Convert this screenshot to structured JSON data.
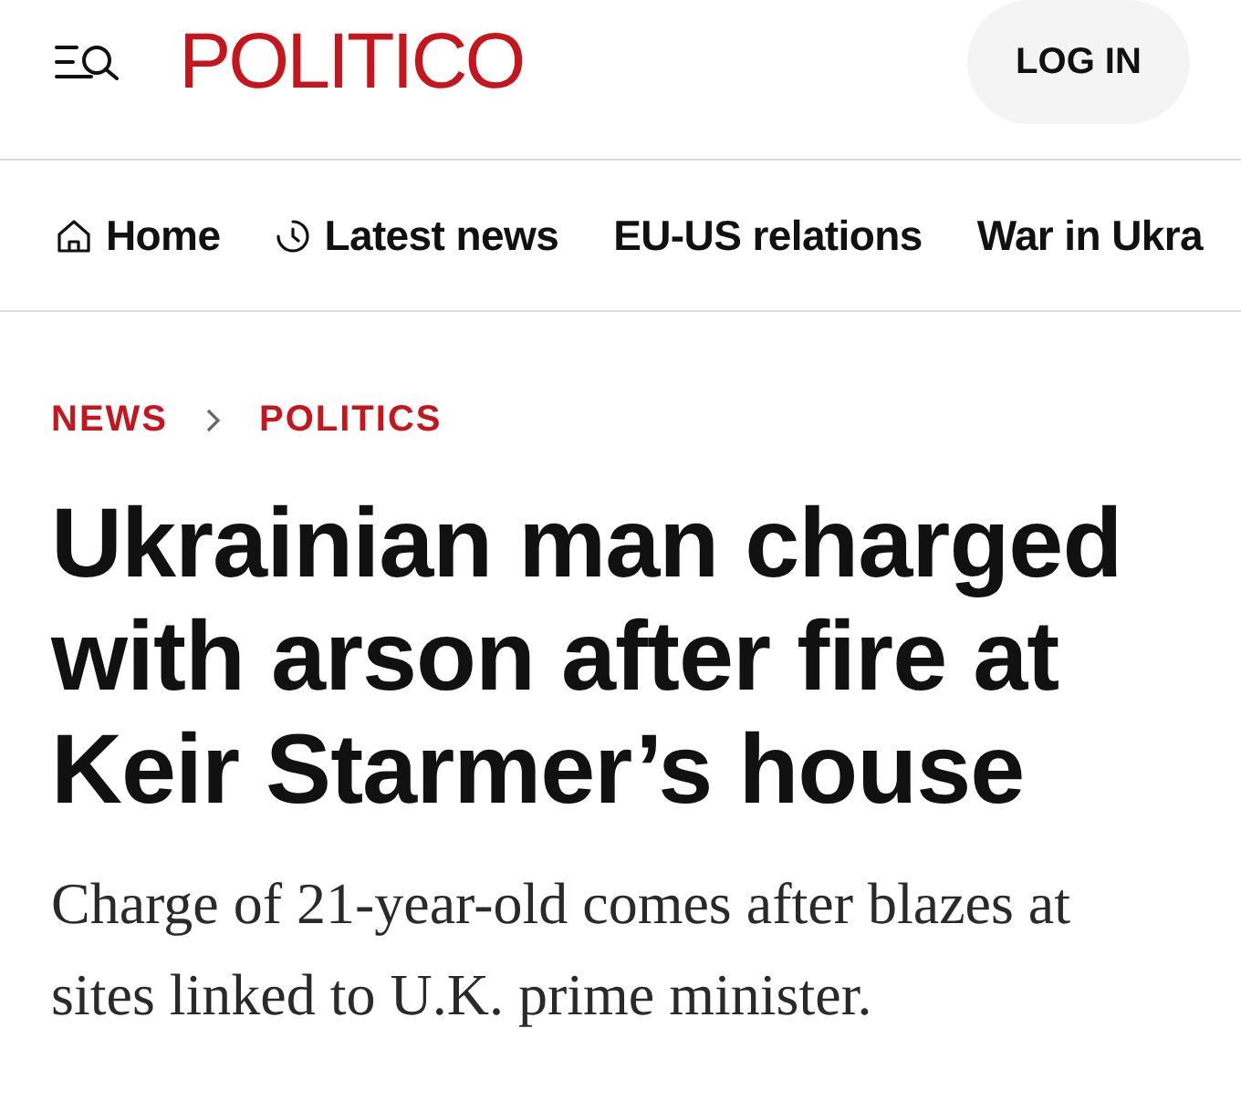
{
  "header": {
    "logo": "POLITICO",
    "login_button": "LOG IN"
  },
  "nav": {
    "items": [
      {
        "label": "Home",
        "kind": "home"
      },
      {
        "label": "Latest news",
        "kind": "recent"
      },
      {
        "label": "EU-US relations",
        "kind": "topic"
      },
      {
        "label": "War in Ukra",
        "kind": "topic"
      }
    ]
  },
  "breadcrumb": [
    "NEWS",
    "POLITICS"
  ],
  "article": {
    "headline": "Ukrainian man charged with arson after fire at Keir Starmer’s house",
    "subtitle": "Charge of 21-year-old comes after blazes at sites linked to U.K. prime minister."
  }
}
